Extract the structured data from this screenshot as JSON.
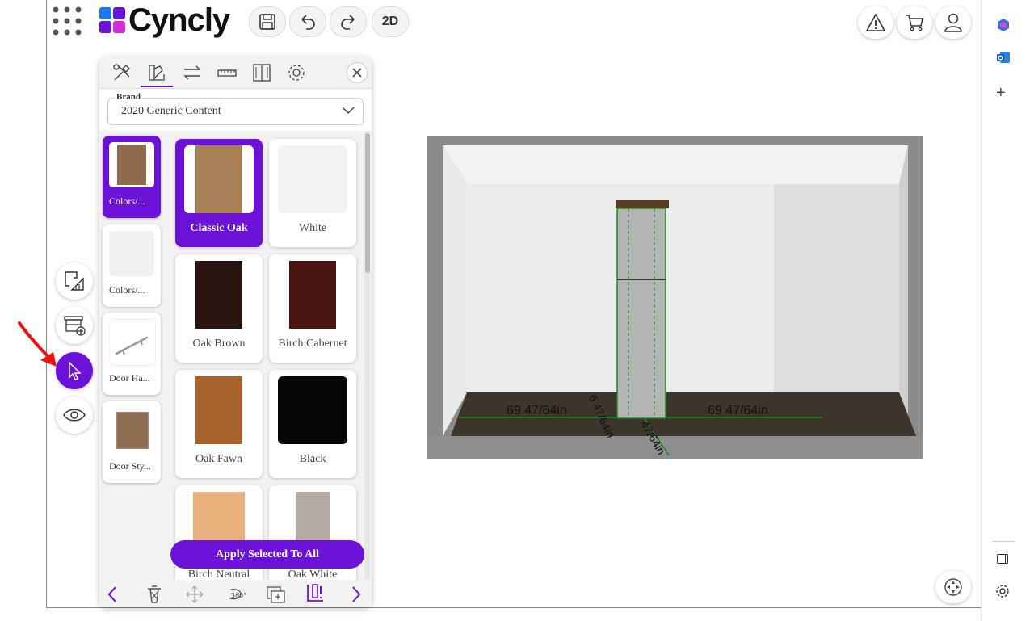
{
  "app": {
    "logo_text": "Cyncly",
    "mode_button": "2D"
  },
  "topbar": {
    "left_icons": [
      "grid-menu-icon",
      "save-icon",
      "undo-icon",
      "redo-icon"
    ],
    "right_icons": [
      "warning-icon",
      "cart-icon",
      "user-icon"
    ]
  },
  "panel": {
    "tabs": [
      "tools-icon",
      "materials-icon",
      "swap-icon",
      "ruler-icon",
      "door-icon",
      "settings-icon"
    ],
    "active_tab": 1,
    "brand_label": "Brand",
    "brand_value": "2020 Generic Content",
    "categories": [
      {
        "label": "Colors/...",
        "swatch": "#8e6b4b",
        "active": true
      },
      {
        "label": "Colors/...",
        "swatch": "#f0f0f0",
        "active": false
      },
      {
        "label": "Door Ha...",
        "swatch": "#ffffff",
        "active": false
      },
      {
        "label": "Door Sty...",
        "swatch": "#8f6d50",
        "active": false
      }
    ],
    "materials": [
      {
        "label": "Classic Oak",
        "color": "#a88058",
        "active": true
      },
      {
        "label": "White",
        "color": "#f3f3f3",
        "active": false
      },
      {
        "label": "Oak Brown",
        "color": "#2a1410",
        "active": false
      },
      {
        "label": "Birch Cabernet",
        "color": "#4a1412",
        "active": false
      },
      {
        "label": "Oak Fawn",
        "color": "#a8622c",
        "active": false
      },
      {
        "label": "Black",
        "color": "#050505",
        "active": false
      },
      {
        "label": "Birch Neutral",
        "color": "#e8b07a",
        "active": false
      },
      {
        "label": "Oak White",
        "color": "#b7aca4",
        "active": false
      }
    ],
    "apply_button": "Apply Selected To All",
    "bottom_icons": [
      "prev-icon",
      "trash-icon",
      "move-icon",
      "rotate-360-icon",
      "duplicate-icon",
      "align-icon",
      "next-icon"
    ]
  },
  "left_tools": [
    "floor-plan-icon",
    "add-cabinet-icon",
    "select-pointer-icon",
    "view-eye-icon"
  ],
  "viewport": {
    "dim_left": "69 47/64in",
    "dim_right": "69 47/64in",
    "dim_depth": "6 47/64in",
    "dim_diag": "47/64in"
  },
  "edge_sidebar": {
    "icons": [
      "copilot-icon",
      "outlook-icon",
      "plus-icon",
      "sidebar-toggle-icon",
      "settings-icon"
    ]
  },
  "colors": {
    "accent": "#6c12d8",
    "dimension_line": "#1a8a1a"
  }
}
